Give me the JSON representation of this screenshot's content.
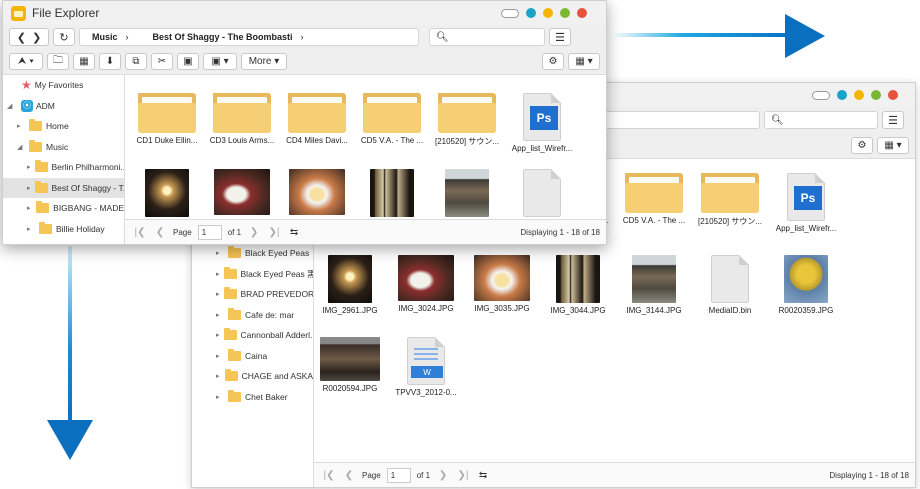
{
  "front": {
    "title": "File Explorer",
    "path": [
      "Music",
      "Best Of Shaggy - The Boombasti"
    ],
    "more_label": "More",
    "tree": [
      {
        "label": "My Favorites",
        "icon": "star-icon",
        "indent": 0
      },
      {
        "label": "ADM",
        "icon": "adm-icon",
        "indent": 0
      },
      {
        "label": "Home",
        "icon": "folder-icon",
        "indent": 1
      },
      {
        "label": "Music",
        "icon": "folder-icon",
        "indent": 1
      },
      {
        "label": "Berlin Philharmoni...",
        "icon": "folder-icon",
        "indent": 2
      },
      {
        "label": "Best Of Shaggy - T...",
        "icon": "folder-icon",
        "indent": 2,
        "selected": true
      },
      {
        "label": "BIGBANG - MADE",
        "icon": "folder-icon",
        "indent": 2
      },
      {
        "label": "Billie Holiday",
        "icon": "folder-icon",
        "indent": 2
      }
    ],
    "items": [
      {
        "label": "CD1 Duke Ellin...",
        "kind": "folder"
      },
      {
        "label": "CD3 Louis Arms...",
        "kind": "folder"
      },
      {
        "label": "CD4 Miles Davi...",
        "kind": "folder"
      },
      {
        "label": "CD5 V.A. - The ...",
        "kind": "folder"
      },
      {
        "label": "[210520] サウン...",
        "kind": "folder"
      },
      {
        "label": "App_list_Wirefr...",
        "kind": "ps"
      },
      {
        "label": "",
        "kind": "lantern"
      },
      {
        "label": "",
        "kind": "food1"
      },
      {
        "label": "",
        "kind": "food2"
      },
      {
        "label": "",
        "kind": "window"
      },
      {
        "label": "",
        "kind": "house"
      },
      {
        "label": "",
        "kind": "blank"
      }
    ],
    "pager": {
      "page_label": "Page",
      "page_value": "1",
      "of_label": "of 1",
      "status": "Displaying 1 - 18 of 18"
    }
  },
  "back": {
    "tree": [
      {
        "label": "Berlin Philharmoni...",
        "indent": 2
      },
      {
        "label": "Best Of Shaggy - T...",
        "indent": 2,
        "selected": true
      },
      {
        "label": "BIGBANG - MADE",
        "indent": 2
      },
      {
        "label": "Billie Holiday",
        "indent": 2
      },
      {
        "label": "Black Eyed Peas",
        "indent": 2
      },
      {
        "label": "Black Eyed Peas 黑...",
        "indent": 2
      },
      {
        "label": "BRAD PREVEDOROS",
        "indent": 2
      },
      {
        "label": "Cafe de: mar",
        "indent": 2
      },
      {
        "label": "Cannonball Adderl...",
        "indent": 2
      },
      {
        "label": "Caina",
        "indent": 2
      },
      {
        "label": "CHAGE and ASKA",
        "indent": 2
      },
      {
        "label": "Chet Baker",
        "indent": 2
      }
    ],
    "items": [
      {
        "label": "",
        "kind": "folder"
      },
      {
        "label": "CD1 Duke Ellin...",
        "kind": "folder"
      },
      {
        "label": "CD3 Louis Arms...",
        "kind": "folder"
      },
      {
        "label": "CD4 Miles Davi...",
        "kind": "folder"
      },
      {
        "label": "CD5 V.A. - The ...",
        "kind": "folder"
      },
      {
        "label": "[210520] サウン...",
        "kind": "folder"
      },
      {
        "label": "App_list_Wirefr...",
        "kind": "ps"
      },
      {
        "label": "IMG_2961.JPG",
        "kind": "lantern"
      },
      {
        "label": "IMG_3024.JPG",
        "kind": "food1"
      },
      {
        "label": "IMG_3035.JPG",
        "kind": "food2"
      },
      {
        "label": "IMG_3044.JPG",
        "kind": "window"
      },
      {
        "label": "IMG_3144.JPG",
        "kind": "house"
      },
      {
        "label": "MediaID.bin",
        "kind": "blank"
      },
      {
        "label": "R0020359.JPG",
        "kind": "tree"
      },
      {
        "label": "R0020594.JPG",
        "kind": "temple"
      },
      {
        "label": "TPVV3_2012-0...",
        "kind": "word"
      }
    ],
    "pager": {
      "page_label": "Page",
      "page_value": "1",
      "of_label": "of 1",
      "status": "Displaying 1 - 18 of 18"
    }
  }
}
